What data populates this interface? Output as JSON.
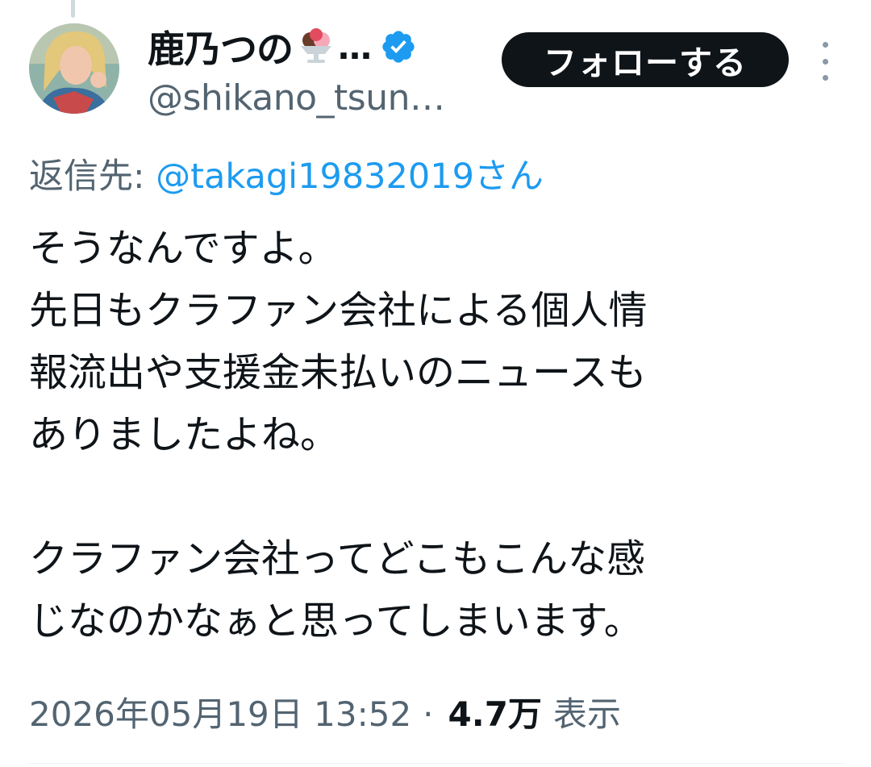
{
  "author": {
    "display_name": "鹿乃つの",
    "name_ellipsis": "…",
    "name_emoji": "ice-cream-sundae-icon",
    "verified": true,
    "handle": "@shikano_tsun…"
  },
  "actions": {
    "follow_label": "フォローする",
    "more_icon": "more-vertical-icon"
  },
  "reply": {
    "prefix": "返信先: ",
    "mention": "@takagi19832019さん"
  },
  "tweet": {
    "text": "そうなんですよ。\n先日もクラファン会社による個人情\n報流出や支援金未払いのニュースも\nありましたよね。\n\nクラファン会社ってどこもこんな感\nじなのかなぁと思ってしまいます。"
  },
  "meta": {
    "timestamp": "2026年05月19日 13:52",
    "separator": "·",
    "views": "4.7万",
    "views_label": "表示"
  },
  "colors": {
    "text": "#0f1419",
    "secondary": "#536471",
    "accent": "#1d9bf0",
    "button": "#0f1419"
  }
}
